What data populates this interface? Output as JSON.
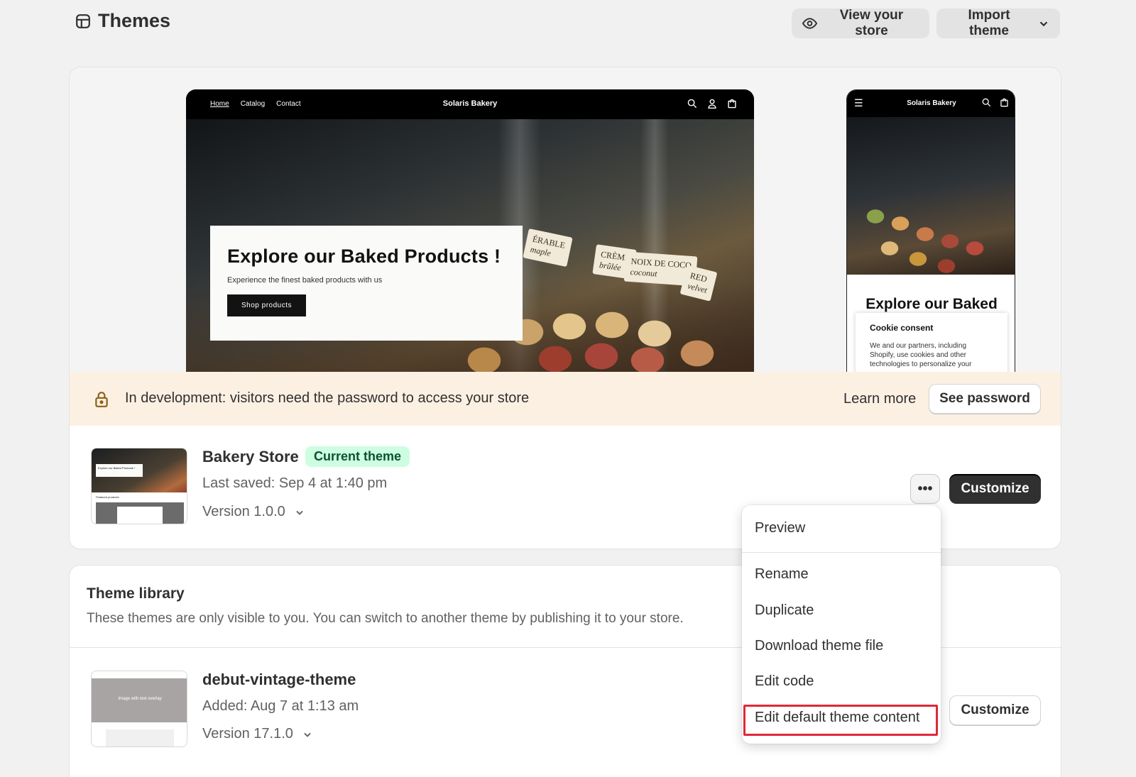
{
  "header": {
    "title": "Themes",
    "view_store_label": "View your store",
    "import_theme_label": "Import theme"
  },
  "preview": {
    "desktop": {
      "nav_links": [
        "Home",
        "Catalog",
        "Contact"
      ],
      "brand": "Solaris Bakery",
      "hero_title": "Explore our Baked Products !",
      "hero_subtitle": "Experience the finest baked products with us",
      "shop_button": "Shop products",
      "labels": [
        "ÉRABLE",
        "maple",
        "CRÈME",
        "brûlée",
        "NOIX DE COCO",
        "coconut",
        "RED",
        "velvet"
      ]
    },
    "mobile": {
      "brand": "Solaris Bakery",
      "hero_title": "Explore our Baked",
      "cookie_title": "Cookie consent",
      "cookie_text": "We and our partners, including Shopify, use cookies and other technologies to personalize your"
    }
  },
  "dev_banner": {
    "message": "In development: visitors need the password to access your store",
    "learn_more": "Learn more",
    "see_password": "See password"
  },
  "current_theme": {
    "name": "Bakery Store",
    "badge": "Current theme",
    "last_saved": "Last saved: Sep 4 at 1:40 pm",
    "version": "Version 1.0.0",
    "more_label": "•••",
    "customize_label": "Customize",
    "thumb_title": "Explore our Baked Products !",
    "thumb_section": "Featured products"
  },
  "library": {
    "title": "Theme library",
    "subtitle": "These themes are only visible to you. You can switch to another theme by publishing it to your store.",
    "items": [
      {
        "name": "debut-vintage-theme",
        "added": "Added: Aug 7 at 1:13 am",
        "version": "Version 17.1.0",
        "customize_label": "Customize",
        "thumb_text": "Image with text overlay"
      }
    ]
  },
  "menu": {
    "items": [
      "Preview",
      "Rename",
      "Duplicate",
      "Download theme file",
      "Edit code",
      "Edit default theme content"
    ],
    "highlight_color": "#e0283a"
  }
}
